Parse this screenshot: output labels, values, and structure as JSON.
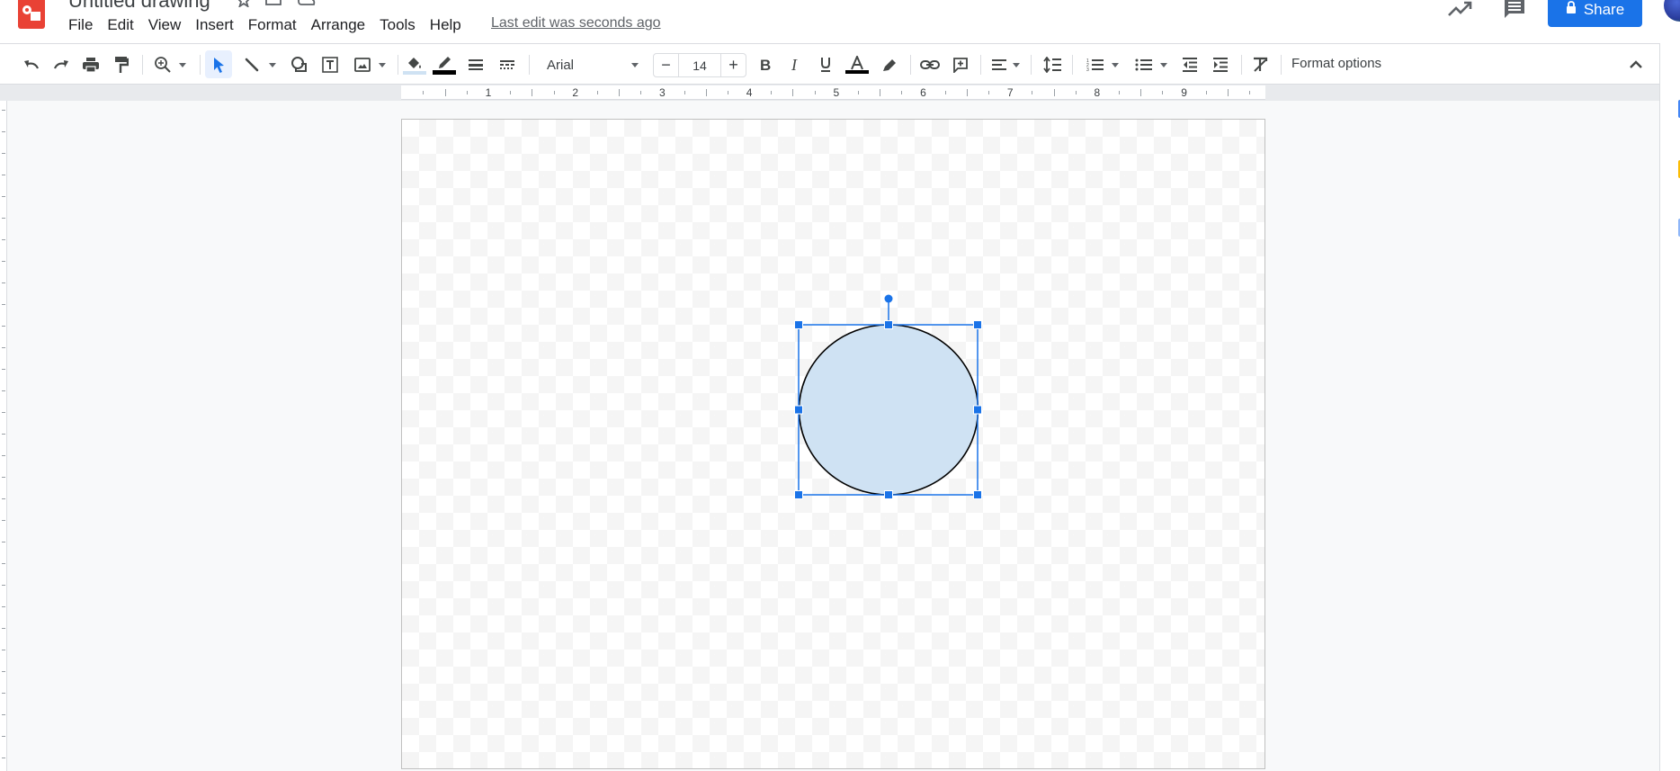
{
  "app": {
    "title": "Untitled drawing",
    "logo_icon": "google-drawings-logo",
    "title_icons": [
      "star-icon",
      "move-to-folder-icon",
      "cloud-status-icon"
    ]
  },
  "menu": {
    "items": [
      "File",
      "Edit",
      "View",
      "Insert",
      "Format",
      "Arrange",
      "Tools",
      "Help"
    ],
    "last_edit": "Last edit was seconds ago"
  },
  "header_actions": {
    "activity_icon": "trending-up-icon",
    "comments_icon": "comment-icon",
    "share_label": "Share",
    "share_icon": "lock-icon",
    "share_color": "#1a73e8"
  },
  "toolbar": {
    "tools": [
      {
        "name": "undo",
        "icon": "undo-icon"
      },
      {
        "name": "redo",
        "icon": "redo-icon"
      },
      {
        "name": "print",
        "icon": "print-icon"
      },
      {
        "name": "paint-format",
        "icon": "paint-roller-icon"
      },
      {
        "name": "zoom",
        "icon": "zoom-in-icon"
      },
      {
        "name": "select",
        "icon": "cursor-arrow-icon",
        "active": true
      },
      {
        "name": "line",
        "icon": "line-icon"
      },
      {
        "name": "shape",
        "icon": "shape-icon"
      },
      {
        "name": "text-box",
        "icon": "text-box-icon"
      },
      {
        "name": "image",
        "icon": "image-icon"
      },
      {
        "name": "fill-color",
        "icon": "paint-bucket-icon",
        "color": "#cfe2f3"
      },
      {
        "name": "border-color",
        "icon": "pencil-icon",
        "color": "#000000"
      },
      {
        "name": "border-weight",
        "icon": "line-weight-icon"
      },
      {
        "name": "border-dash",
        "icon": "line-dash-icon"
      }
    ],
    "font": "Arial",
    "font_size": "14",
    "font_size_minus": "−",
    "font_size_plus": "+",
    "text_color": "#000000",
    "format_options": "Format options"
  },
  "ruler": {
    "labels": [
      "1",
      "2",
      "3",
      "4",
      "5",
      "6",
      "7",
      "8",
      "9"
    ]
  },
  "canvas": {
    "shape": {
      "type": "ellipse",
      "fill": "#cfe2f3",
      "stroke": "#000000",
      "selected": true,
      "selection_color": "#1a73e8"
    }
  },
  "side_panel": {
    "icons": [
      "calendar-icon",
      "keep-icon",
      "tasks-icon"
    ]
  }
}
